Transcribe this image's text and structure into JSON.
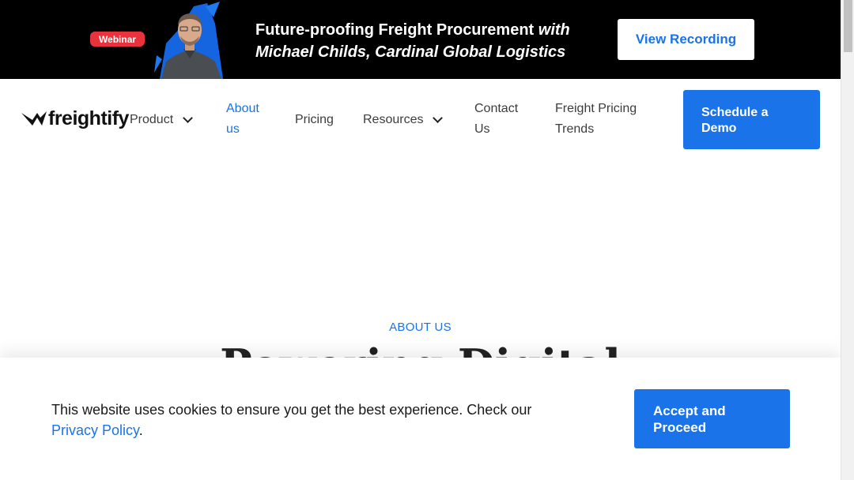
{
  "banner": {
    "badge": "Webinar",
    "title_main": "Future-proofing Freight Procurement ",
    "title_with": "with",
    "title_line2": "Michael Childs, Cardinal Global Logistics",
    "cta": "View Recording"
  },
  "header": {
    "logo_text": "freightify",
    "nav": {
      "product": "Product",
      "about_line1": "About",
      "about_line2": "us",
      "pricing": "Pricing",
      "resources": "Resources",
      "contact_line1": "Contact",
      "contact_line2": "Us",
      "trends_line1": "Freight Pricing",
      "trends_line2": "Trends"
    },
    "demo_line1": "Schedule a",
    "demo_line2": "Demo"
  },
  "hero": {
    "eyebrow": "ABOUT US",
    "heading": "Powering Digital"
  },
  "cookie": {
    "text": "This website uses cookies to ensure you get the best experience. Check our ",
    "link": "Privacy Policy",
    "suffix": ".",
    "accept_line1": "Accept and",
    "accept_line2": "Proceed"
  },
  "colors": {
    "brand_blue": "#1a73e8",
    "badge_red": "#e8323c",
    "banner_bg": "#000000"
  }
}
